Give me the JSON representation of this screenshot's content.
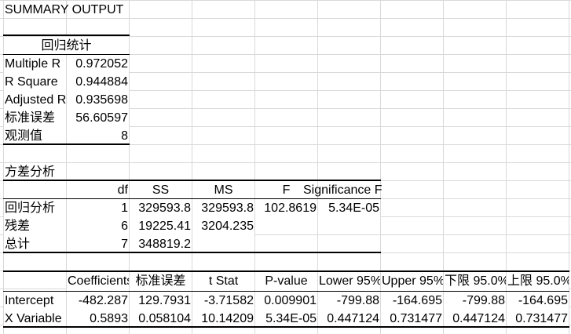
{
  "sheet": {
    "title": "SUMMARY OUTPUT",
    "regression_stats": {
      "header": "回归统计",
      "rows": [
        {
          "label": "Multiple R",
          "value": "0.972052"
        },
        {
          "label": "R Square",
          "value": "0.944884"
        },
        {
          "label": "Adjusted R Square",
          "value": "0.935698"
        },
        {
          "label": "标准误差",
          "value": "56.60597"
        },
        {
          "label": "观测值",
          "value": "8"
        }
      ]
    },
    "anova": {
      "title": "方差分析",
      "headers": [
        "df",
        "SS",
        "MS",
        "F",
        "Significance F"
      ],
      "rows": [
        {
          "label": "回归分析",
          "df": "1",
          "ss": "329593.8",
          "ms": "329593.8",
          "f": "102.8619",
          "sigf": "5.34E-05"
        },
        {
          "label": "残差",
          "df": "6",
          "ss": "19225.41",
          "ms": "3204.235",
          "f": "",
          "sigf": ""
        },
        {
          "label": "总计",
          "df": "7",
          "ss": "348819.2",
          "ms": "",
          "f": "",
          "sigf": ""
        }
      ]
    },
    "coefficients": {
      "headers": [
        "Coefficients",
        "标准误差",
        "t Stat",
        "P-value",
        "Lower 95%",
        "Upper 95%",
        "下限 95.0%",
        "上限 95.0%"
      ],
      "rows": [
        {
          "label": "Intercept",
          "values": [
            "-482.287",
            "129.7931",
            "-3.71582",
            "0.009901",
            "-799.88",
            "-164.695",
            "-799.88",
            "-164.695"
          ]
        },
        {
          "label": "X Variable",
          "values": [
            "0.5893",
            "0.058104",
            "10.14209",
            "5.34E-05",
            "0.447124",
            "0.731477",
            "0.447124",
            "0.731477"
          ]
        }
      ]
    }
  }
}
